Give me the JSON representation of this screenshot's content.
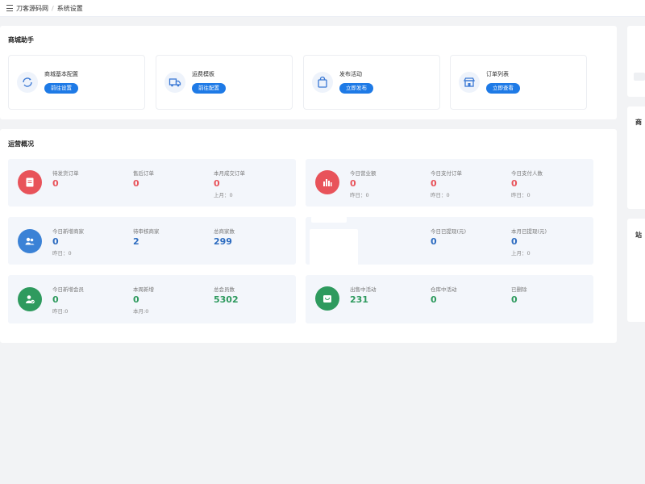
{
  "breadcrumb": {
    "home": "刀客源码网",
    "current": "系统设置"
  },
  "helper_section": {
    "title": "商城助手",
    "items": [
      {
        "label": "商城基本配置",
        "button": "前往设置",
        "icon": "refresh-icon"
      },
      {
        "label": "运费模板",
        "button": "前往配置",
        "icon": "truck-icon"
      },
      {
        "label": "发布活动",
        "button": "立即发布",
        "icon": "bag-icon"
      },
      {
        "label": "订单列表",
        "button": "立即查看",
        "icon": "shop-icon"
      }
    ]
  },
  "ops_section": {
    "title": "运营概况",
    "orders": {
      "stats": [
        {
          "label": "待发货订单",
          "value": "0"
        },
        {
          "label": "售后订单",
          "value": "0"
        },
        {
          "label": "本月成交订单",
          "value": "0",
          "sub": "上月：0"
        }
      ]
    },
    "revenue": {
      "stats": [
        {
          "label": "今日营业额",
          "value": "0",
          "sub": "昨日：0"
        },
        {
          "label": "今日支付订单",
          "value": "0",
          "sub": "昨日：0"
        },
        {
          "label": "今日支付人数",
          "value": "0",
          "sub": "昨日：0"
        }
      ]
    },
    "merchants": {
      "stats": [
        {
          "label": "今日新增商家",
          "value": "0",
          "sub": "昨日：0"
        },
        {
          "label": "待审核商家",
          "value": "2"
        },
        {
          "label": "总商家数",
          "value": "299"
        }
      ]
    },
    "withdraw": {
      "stats": [
        {
          "label": "今日已提现(元)",
          "value": "0"
        },
        {
          "label": "本月已提现(元)",
          "value": "0",
          "sub": "上月：0"
        }
      ]
    },
    "members": {
      "stats": [
        {
          "label": "今日新增会员",
          "value": "0",
          "sub": "昨日:0"
        },
        {
          "label": "本周新增",
          "value": "0",
          "sub": "本月:0"
        },
        {
          "label": "总会员数",
          "value": "5302"
        }
      ]
    },
    "activities": {
      "stats": [
        {
          "label": "出售中活动",
          "value": "231"
        },
        {
          "label": "仓库中活动",
          "value": "0"
        },
        {
          "label": "已删除",
          "value": "0"
        }
      ]
    }
  },
  "side": {
    "card2_title": "商",
    "card3_title": "站"
  },
  "colors": {
    "red": "#e8535a",
    "blue": "#2d6cc0",
    "green": "#2e9a5e",
    "accent": "#1e7ae6"
  }
}
